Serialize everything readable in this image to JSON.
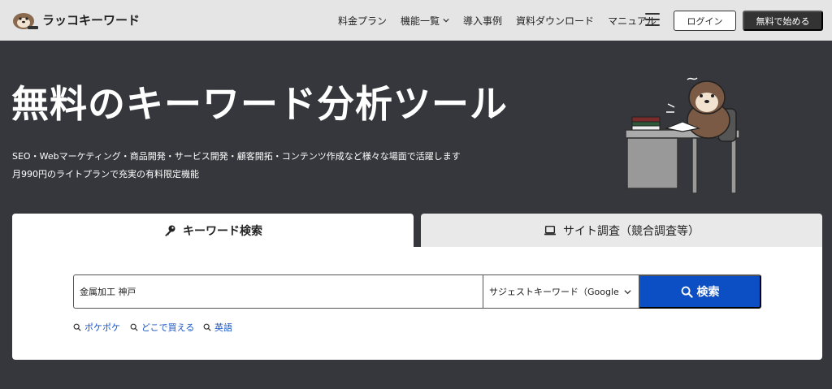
{
  "header": {
    "logo_text": "ラッコキーワード",
    "nav": [
      {
        "label": "料金プラン",
        "has_dropdown": false
      },
      {
        "label": "機能一覧",
        "has_dropdown": true
      },
      {
        "label": "導入事例",
        "has_dropdown": false
      },
      {
        "label": "資料ダウンロード",
        "has_dropdown": false
      },
      {
        "label": "マニュアル",
        "has_dropdown": false
      }
    ],
    "menu_icon": "hamburger-icon",
    "login_label": "ログイン",
    "start_label": "無料で始める"
  },
  "hero": {
    "title": "無料のキーワード分析ツール",
    "subtitle_1": "SEO・Webマーケティング・商品開発・サービス開発・顧客開拓・コンテンツ作成など様々な場面で活躍します",
    "subtitle_2": "月990円のライトプランで充実の有料限定機能"
  },
  "tabs": [
    {
      "label": "キーワード検索",
      "icon": "key-icon",
      "active": true
    },
    {
      "label": "サイト調査（競合調査等）",
      "icon": "laptop-icon",
      "active": false
    }
  ],
  "search": {
    "value": "金属加工 神戸",
    "select_value": "サジェストキーワード（Google）",
    "button_label": "検索",
    "suggestions": [
      "ポケポケ",
      "どこで買える",
      "英語"
    ]
  },
  "colors": {
    "background": "#36373c",
    "header": "#e5e5e5",
    "accent": "#0c4fc4",
    "link": "#1a56c4"
  }
}
